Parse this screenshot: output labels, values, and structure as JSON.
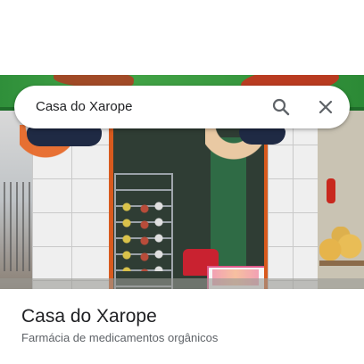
{
  "search": {
    "query": "Casa do Xarope",
    "search_icon": "search-icon",
    "close_icon": "close-icon"
  },
  "photo": {
    "description_icon": "storefront-photo"
  },
  "place": {
    "title": "Casa do Xarope",
    "category": "Farmácia de medicamentos orgânicos"
  },
  "colors": {
    "icon_gray": "#5f6368",
    "title_text": "#202124",
    "subtitle_text": "#5f6368",
    "sign_green": "#43a447",
    "door_orange": "#d85a1e"
  }
}
